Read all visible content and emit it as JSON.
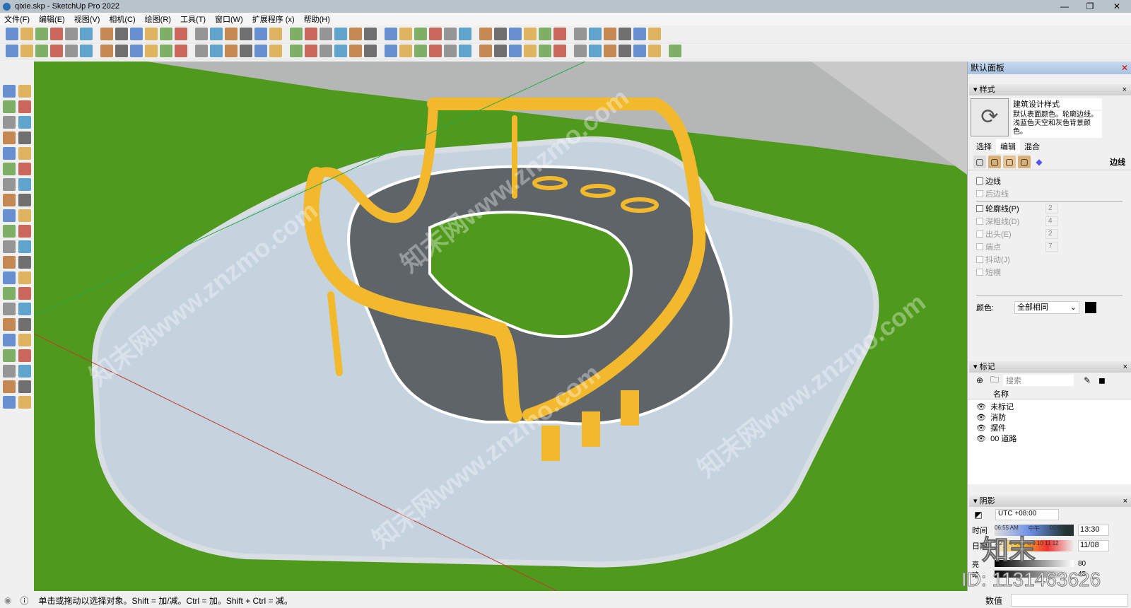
{
  "window": {
    "title": "qixie.skp - SketchUp Pro 2022",
    "minimize": "—",
    "maximize": "❐",
    "close": "✕"
  },
  "menu": [
    "文件(F)",
    "编辑(E)",
    "视图(V)",
    "相机(C)",
    "绘图(R)",
    "工具(T)",
    "窗口(W)",
    "扩展程序 (x)",
    "帮助(H)"
  ],
  "toolbar1": [
    "new-icon",
    "open-icon",
    "save-icon",
    "cut-icon",
    "copy-icon",
    "paste-icon",
    "erase-icon",
    "undo-icon",
    "redo-icon",
    "print-icon",
    "model-info-icon",
    "iso-view-icon",
    "top-view-icon",
    "front-view-icon",
    "right-view-icon",
    "back-view-icon",
    "left-view-icon",
    "bottom-view-icon",
    "warehouse-icon",
    "extension-icon",
    "house-icon",
    "section-plane-icon",
    "section-display-icon",
    "component-icon",
    "group-icon",
    "solid-union-icon",
    "solid-subtract-icon",
    "solid-trim-icon",
    "xray-icon",
    "back-edges-icon",
    "wireframe-icon",
    "hidden-line-icon",
    "shaded-icon",
    "textured-icon",
    "monochrome-icon",
    "shadow-icon",
    "fog-icon",
    "match-photo-icon",
    "sandbox-icon",
    "layer-icon",
    "outliner-icon",
    "scene-icon"
  ],
  "toolbar2": [
    "layout-icon",
    "style-builder-icon",
    "dimension-icon",
    "stair-icon",
    "wall-icon",
    "column-icon",
    "beam-icon",
    "pipe-icon",
    "curve-icon",
    "offset-icon",
    "loft-icon",
    "extrude-icon",
    "follow-icon",
    "bend-icon",
    "twist-icon",
    "spring-icon",
    "array-icon",
    "grid-icon",
    "roof-icon",
    "window-icon",
    "door-icon",
    "rail-icon",
    "fence-icon",
    "tree-icon",
    "person-icon",
    "car-icon",
    "label-icon",
    "tag-icon",
    "skin-icon",
    "xyz-icon",
    "sub-icon",
    "play-icon",
    "stop-icon",
    "render-icon",
    "light-icon",
    "material-icon",
    "axis-x-icon",
    "axis-y-icon",
    "axis-z-icon",
    "mirror-icon",
    "scale-icon",
    "flip-icon",
    "export-icon"
  ],
  "lefttools": [
    "select-icon",
    "orbit-icon",
    "paint-bucket-icon",
    "eraser-icon",
    "tape-icon",
    "pencil-icon",
    "line-icon",
    "freehand-icon",
    "rectangle-icon",
    "rotated-rect-icon",
    "circle-icon",
    "polygon-icon",
    "arc-icon",
    "pie-icon",
    "arc3-icon",
    "arc2-icon",
    "move-icon",
    "push-pull-icon",
    "rotate-icon",
    "follow-me-icon",
    "scale-icon",
    "offset-icon",
    "tape-measure-icon",
    "dimension-icon",
    "protractor-icon",
    "text-icon",
    "axes-icon",
    "3d-text-icon",
    "orbit2-icon",
    "pan-icon",
    "zoom-icon",
    "zoom-window-icon",
    "zoom-extents-icon",
    "previous-view-icon",
    "position-camera-icon",
    "look-around-icon",
    "walk-icon",
    "section-icon",
    "sandbox-icon",
    "smoove-icon",
    "stamp-icon",
    "drape-icon"
  ],
  "panel": {
    "title": "默认面板",
    "styles": {
      "header": "样式",
      "name": "建筑设计样式",
      "description": "默认表面颜色。轮廓边线。浅蓝色天空和灰色背景颜色。",
      "tabs": [
        "选择",
        "编辑",
        "混合"
      ],
      "active_tab": "编辑",
      "edge_label": "边线",
      "edges": [
        {
          "label": "边线",
          "checked": false,
          "enabled": true
        },
        {
          "label": "后边线",
          "checked": false,
          "enabled": false
        }
      ],
      "options": [
        {
          "label": "轮廓线(P)",
          "value": "2",
          "enabled": true
        },
        {
          "label": "深粗线(D)",
          "value": "4",
          "enabled": false
        },
        {
          "label": "出头(E)",
          "value": "2",
          "enabled": false
        },
        {
          "label": "端点",
          "value": "7",
          "enabled": false
        },
        {
          "label": "抖动(J)",
          "value": "",
          "enabled": false
        },
        {
          "label": "短横",
          "value": "",
          "enabled": false
        }
      ],
      "color_label": "颜色:",
      "color_value": "全部相同",
      "color_swatch": "#000000"
    },
    "tags": {
      "header": "标记",
      "search_placeholder": "搜索",
      "column": "名称",
      "items": [
        "未标记",
        "消防",
        "摆件",
        "00 道路"
      ]
    },
    "shadows": {
      "header": "阴影",
      "timezone": "UTC +08:00",
      "time_label": "时间",
      "time_start": "06:55 AM",
      "time_mid": "中午",
      "time_end": "05:00 PM",
      "time_value": "13:30",
      "date_label": "日期",
      "months": "1 2 3 4 5 6 7 8 9 10 11 12",
      "date_value": "11/08",
      "light_label": "亮",
      "light_value": "80",
      "dark_label": "暗",
      "dark_value": "45"
    }
  },
  "status": {
    "message": "单击或拖动以选择对象。Shift = 加/减。Ctrl = 加。Shift + Ctrl = 减。",
    "measurements_label": "数值"
  },
  "watermarks": {
    "site": "知末网www.znzmo.com",
    "logo": "知末",
    "id": "ID: 1131463626"
  },
  "colors": {
    "grass": "#4f9a1c",
    "pavement": "#c5d3df",
    "track": "#5e6468",
    "structure": "#f2b92c",
    "accent": "#a9c3e0"
  }
}
